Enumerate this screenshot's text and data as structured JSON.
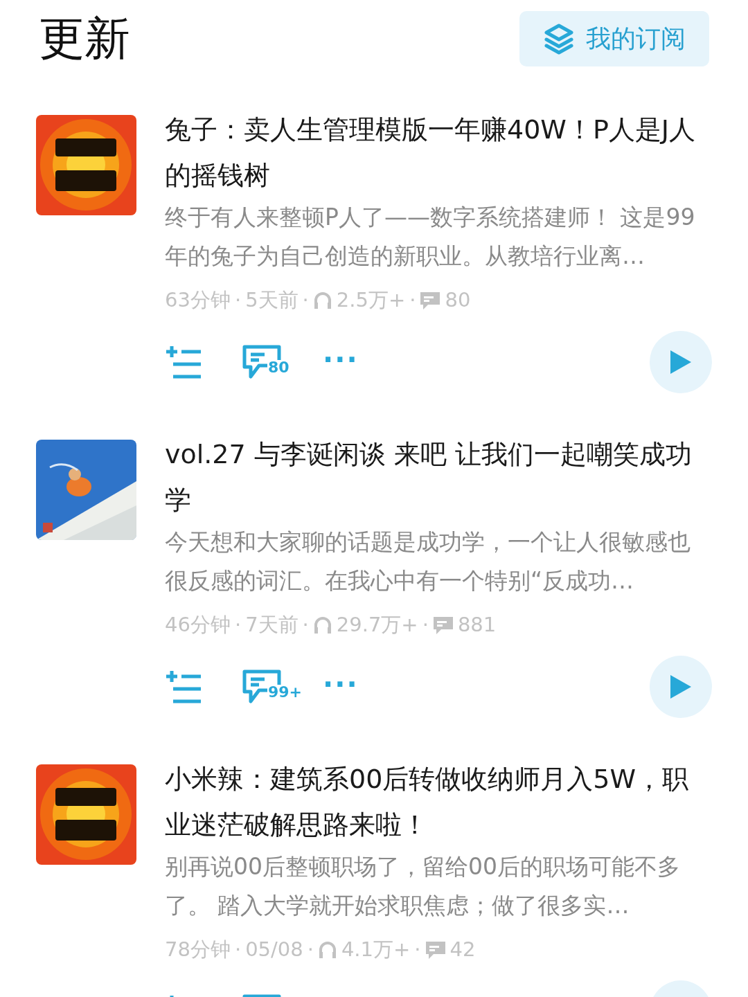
{
  "header": {
    "title": "更新",
    "subscribe_button": "我的订阅"
  },
  "episodes": [
    {
      "separator": "·",
      "title": "兔子：卖人生管理模版一年赚40W！P人是J人的摇钱树",
      "description": "终于有人来整顿P人了——数字系统搭建师！ 这是99年的兔子为自己创造的新职业。从教培行业离…",
      "duration": "63分钟",
      "date": "5天前",
      "plays": "2.5万+",
      "comments": "80",
      "comment_badge": "80",
      "more": "···"
    },
    {
      "separator": "·",
      "title": "vol.27 与李诞闲谈 来吧 让我们一起嘲笑成功学",
      "description": "今天想和大家聊的话题是成功学，一个让人很敏感也很反感的词汇。在我心中有一个特别“反成功…",
      "duration": "46分钟",
      "date": "7天前",
      "plays": "29.7万+",
      "comments": "881",
      "comment_badge": "99+",
      "more": "···"
    },
    {
      "separator": "·",
      "title": "小米辣：建筑系00后转做收纳师月入5W，职业迷茫破解思路来啦！",
      "description": "别再说00后整顿职场了，留给00后的职场可能不多了。 踏入大学就开始求职焦虑；做了很多实…",
      "duration": "78分钟",
      "date": "05/08",
      "plays": "4.1万+",
      "comments": "42"
    }
  ]
}
